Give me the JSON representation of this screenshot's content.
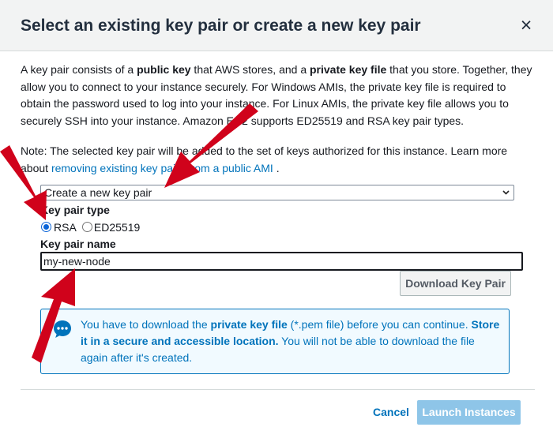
{
  "dialog": {
    "title": "Select an existing key pair or create a new key pair",
    "close_glyph": "×"
  },
  "description": {
    "t1": "A key pair consists of a ",
    "b1": "public key",
    "t2": " that AWS stores, and a ",
    "b2": "private key file",
    "t3": " that you store. Together, they allow you to connect to your instance securely. For Windows AMIs, the private key file is required to obtain the password used to log into your instance. For Linux AMIs, the private key file allows you to securely SSH into your instance. Amazon EC2 supports ED25519 and RSA key pair types."
  },
  "note": {
    "text": "Note: The selected key pair will be added to the set of keys authorized for this instance. Learn more about ",
    "link": "removing existing key pairs from a public AMI",
    "tail": " ."
  },
  "key_pair_select": {
    "value": "Create a new key pair",
    "chevron": "⌄"
  },
  "key_pair_type": {
    "label": "Key pair type",
    "options": [
      "RSA",
      "ED25519"
    ],
    "selected": "RSA"
  },
  "key_pair_name": {
    "label": "Key pair name",
    "value": "my-new-node"
  },
  "download_button": "Download Key Pair",
  "info_box": {
    "t1": "You have to download the ",
    "b1": "private key file",
    "t2": " (*.pem file) before you can continue. ",
    "b2": "Store it in a secure and accessible location.",
    "t3": " You will not be able to download the file again after it's created."
  },
  "footer": {
    "cancel": "Cancel",
    "launch": "Launch Instances"
  },
  "colors": {
    "link": "#0073bb",
    "info_bg": "#f1faff",
    "launch_disabled": "#8ec5e8",
    "annotation_arrow": "#d0021b"
  },
  "icons": [
    "close-icon",
    "chevron-down-icon",
    "chat-info-icon",
    "red-arrow"
  ]
}
